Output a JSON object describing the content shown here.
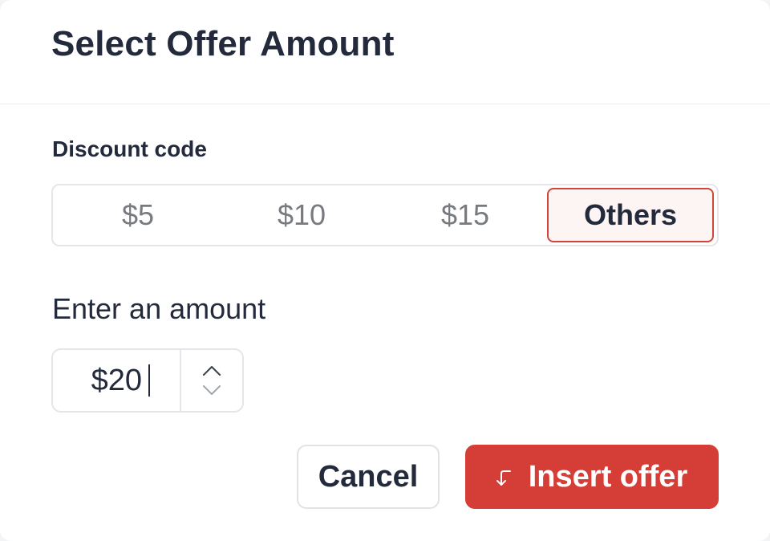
{
  "dialog": {
    "title": "Select Offer Amount"
  },
  "discount": {
    "label": "Discount code",
    "options": [
      {
        "label": "$5",
        "selected": false
      },
      {
        "label": "$10",
        "selected": false
      },
      {
        "label": "$15",
        "selected": false
      },
      {
        "label": "Others",
        "selected": true
      }
    ]
  },
  "amount": {
    "label": "Enter an amount",
    "value": "$20",
    "stepper_icons": [
      "chevron-up-icon",
      "chevron-down-icon"
    ]
  },
  "actions": {
    "cancel_label": "Cancel",
    "insert_label": "Insert offer",
    "insert_icon": "insert-arrow-icon"
  },
  "colors": {
    "accent": "#d53e36",
    "selected_border": "#d1453d",
    "selected_bg": "#fdf5f4",
    "text_primary": "#232a3b",
    "text_muted": "#777b80"
  }
}
